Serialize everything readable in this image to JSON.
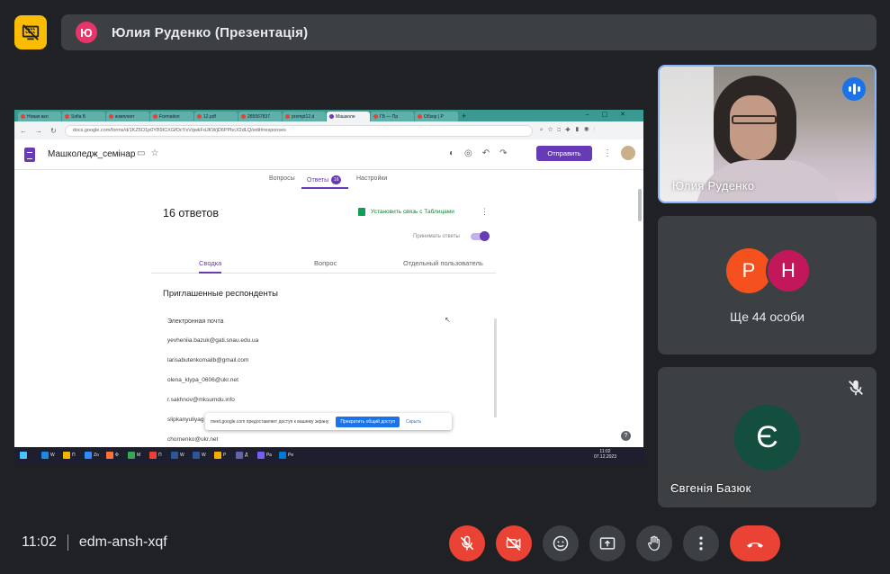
{
  "meeting": {
    "title": "Юлия Руденко (Презентація)",
    "presenter_initial": "Ю",
    "time": "11:02",
    "code": "edm-ansh-xqf"
  },
  "participants": {
    "main": {
      "name": "Юлия Руденко",
      "state": "speaking"
    },
    "group": {
      "initials": [
        "Р",
        "Н"
      ],
      "more_label": "Ще 44 особи"
    },
    "third": {
      "name": "Євгенія Базюк",
      "initial": "Є",
      "muted": true
    }
  },
  "shared_screen": {
    "tabs": [
      "Новая вкл",
      "Sofia Б",
      "комплект",
      "Formation",
      "12.pdf",
      "285567837",
      "prompt12.d",
      "Машколе",
      "ГБ — Пр",
      "Обзор | Р"
    ],
    "url": "docs.google.com/forms/d/1KZ5O1p0YB9ICXGfOcYsVqwkFdJKWjD6PPbcX2dLQ/edit#responses",
    "form_title": "Машколедж_семінар",
    "send_label": "Отправить",
    "tabs_form": {
      "questions": "Вопросы",
      "answers": "Ответы",
      "answers_count": "16",
      "settings": "Настройки"
    },
    "responses_title": "16 ответов",
    "sheets_link": "Установить связь с Таблицами",
    "accepting": "Принимать ответы",
    "view_tabs": {
      "summary": "Сводка",
      "question": "Вопрос",
      "individual": "Отдельный пользователь"
    },
    "invited_title": "Приглашенные респонденты",
    "email_header": "Электронная почта",
    "emails": [
      "yevheniia.bazuk@gati.snau.edu.ua",
      "larisabutenkomailb@gmail.com",
      "olena_klypa_0606@ukr.net",
      "r.sakhnov@mksumdu.info",
      "slipkanyuliyag",
      "chornenko@ukr.net"
    ],
    "share_notice": "meet.google.com предоставляет доступ к вашему экрану",
    "share_stop": "Прекратить общий доступ",
    "share_hide": "Скрыть",
    "taskbar_items": [
      "W",
      "П",
      "Zo",
      "Ф",
      "М",
      "П",
      "W",
      "W",
      "Р",
      "Д",
      "Ра",
      "Pe"
    ],
    "taskbar_time": "11:02",
    "taskbar_date": "07.12.2023"
  },
  "colors": {
    "bg": "#202124",
    "tile": "#3c4043",
    "accent_yellow": "#fbbc04",
    "danger": "#ea4335",
    "active_border": "#8ab4f8",
    "form_purple": "#673ab7"
  },
  "icons": {
    "sharing": "screen-share-off-icon",
    "speaking": "audio-wave-icon",
    "muted": "mic-off-icon",
    "controls": [
      "mic-off-icon",
      "camera-off-icon",
      "emoji-icon",
      "present-icon",
      "raise-hand-icon",
      "more-vert-icon",
      "end-call-icon"
    ]
  }
}
